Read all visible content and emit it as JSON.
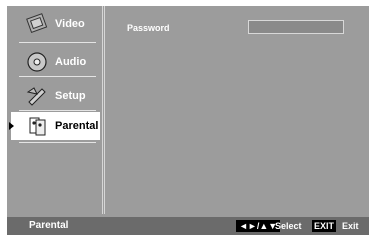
{
  "menu": {
    "items": [
      {
        "label": "Video",
        "icon": "film-icon"
      },
      {
        "label": "Audio",
        "icon": "disc-icon"
      },
      {
        "label": "Setup",
        "icon": "wrench-icon"
      },
      {
        "label": "Parental",
        "icon": "family-icon",
        "selected": true
      }
    ]
  },
  "content": {
    "password_label": "Password",
    "password_value": ""
  },
  "status": {
    "title": "Parental",
    "nav_keys": "◄►/▲▼",
    "select_label": "Select",
    "exit_key": "EXIT",
    "exit_label": "Exit"
  },
  "colors": {
    "background": "#9c9c9c",
    "status_bar": "#6b6b6b",
    "selected_bg": "#ffffff"
  }
}
